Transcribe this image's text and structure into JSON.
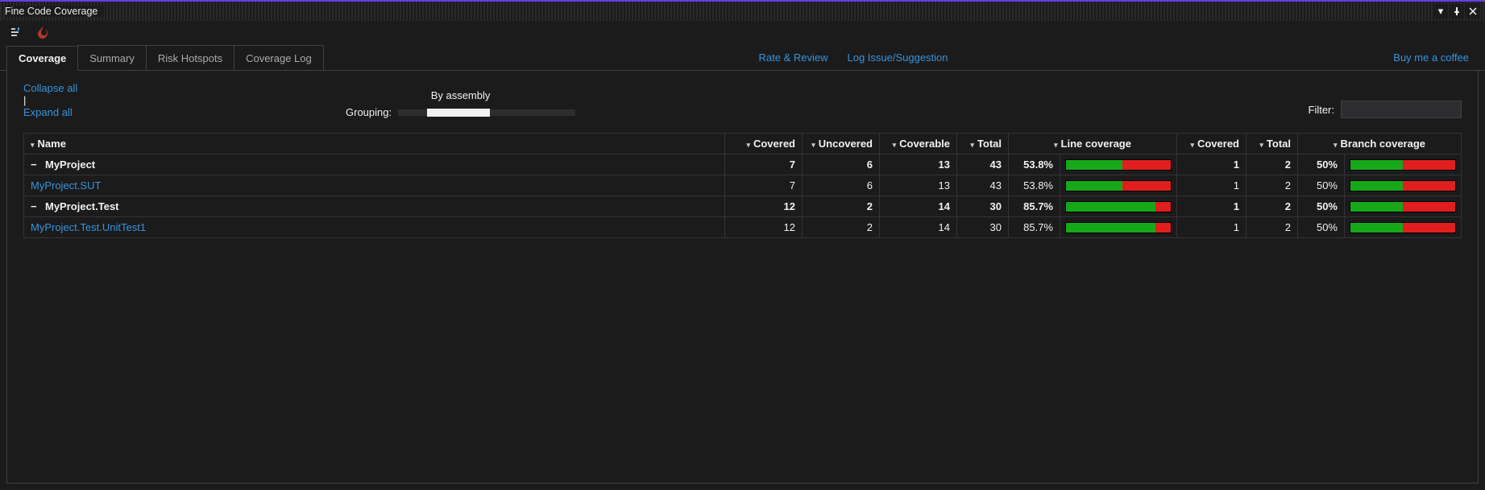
{
  "window": {
    "title": "Fine Code Coverage"
  },
  "tabs": {
    "coverage": "Coverage",
    "summary": "Summary",
    "risk": "Risk Hotspots",
    "log": "Coverage Log",
    "active": "coverage"
  },
  "links": {
    "rate": "Rate & Review",
    "issue": "Log Issue/Suggestion",
    "coffee": "Buy me a coffee"
  },
  "controls": {
    "collapse": "Collapse all",
    "expand": "Expand all",
    "separator": " | ",
    "grouping_label": "Grouping:",
    "by_assembly": "By assembly",
    "filter_label": "Filter:",
    "filter_value": ""
  },
  "headers": {
    "name": "Name",
    "covered": "Covered",
    "uncovered": "Uncovered",
    "coverable": "Coverable",
    "total": "Total",
    "line_coverage": "Line coverage",
    "branch_covered": "Covered",
    "branch_total": "Total",
    "branch_coverage": "Branch coverage"
  },
  "rows": [
    {
      "kind": "group",
      "name": "MyProject",
      "covered": 7,
      "uncovered": 6,
      "coverable": 13,
      "total": 43,
      "line_pct": "53.8%",
      "line_bar": 53.8,
      "b_covered": 1,
      "b_total": 2,
      "b_pct": "50%",
      "b_bar": 50
    },
    {
      "kind": "child",
      "name": "MyProject.SUT",
      "covered": 7,
      "uncovered": 6,
      "coverable": 13,
      "total": 43,
      "line_pct": "53.8%",
      "line_bar": 53.8,
      "b_covered": 1,
      "b_total": 2,
      "b_pct": "50%",
      "b_bar": 50
    },
    {
      "kind": "group",
      "name": "MyProject.Test",
      "covered": 12,
      "uncovered": 2,
      "coverable": 14,
      "total": 30,
      "line_pct": "85.7%",
      "line_bar": 85.7,
      "b_covered": 1,
      "b_total": 2,
      "b_pct": "50%",
      "b_bar": 50
    },
    {
      "kind": "child",
      "name": "MyProject.Test.UnitTest1",
      "covered": 12,
      "uncovered": 2,
      "coverable": 14,
      "total": 30,
      "line_pct": "85.7%",
      "line_bar": 85.7,
      "b_covered": 1,
      "b_total": 2,
      "b_pct": "50%",
      "b_bar": 50
    }
  ]
}
